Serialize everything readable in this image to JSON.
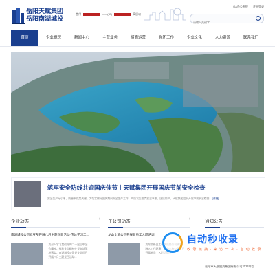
{
  "brand": {
    "line1": "岳阳天赋集团",
    "line2": "岳阳南湖城投"
  },
  "tagline": {
    "prefix": "善付",
    "middle": "——(IC)",
    "suffix": "高质以"
  },
  "toplinks": [
    "OA办公系统",
    "注册登录"
  ],
  "search": {
    "placeholder": "请输入关键字"
  },
  "nav": [
    "首页",
    "企业概况",
    "新闻中心",
    "主营业务",
    "招商运营",
    "党团工作",
    "企业文化",
    "人力资源",
    "联系我们"
  ],
  "highlight": {
    "title": "筑牢安全防线共迎国庆佳节丨天赋集团开展国庆节前安全检查",
    "desc": "安全生产无小事，防患未然是关键。为切实做好国庆期间安全生产工作，严防发生各类安全事故，国庆前夕，天赋集团组织开展节前安全检查...",
    "more": "[详细]"
  },
  "columns": {
    "enterprise": {
      "title": "企业动态",
      "more": "+",
      "headline": "南湖城投公司党支部开展八月主题党日活动·传达学习二...",
      "text": "为深入学习贯彻党的二十届三中全会精神，推动全会精神在党支部落地落实，南湖城投公司党支部近日开展八月主题党日活动..."
    },
    "subsidiary": {
      "title": "子公司动态",
      "more": "+",
      "headline": "龙山文旅公司开展新员工入职培训",
      "text": "为帮助新员工尽快熟悉公司情况、融入工作环境，龙山文旅公司近日开展新员工入职培训..."
    },
    "notice": {
      "title": "通知公告",
      "more": "+",
      "items": [
        "岳阳市天赋投资集团有限公司2024年度..."
      ]
    }
  },
  "watermark": {
    "text": "自动秒收录",
    "sub": "收 录 链 接 · 来 访 一 次 · 自 动 收 录"
  },
  "colors": {
    "primary": "#1a3f8f",
    "accent": "#b22222"
  }
}
